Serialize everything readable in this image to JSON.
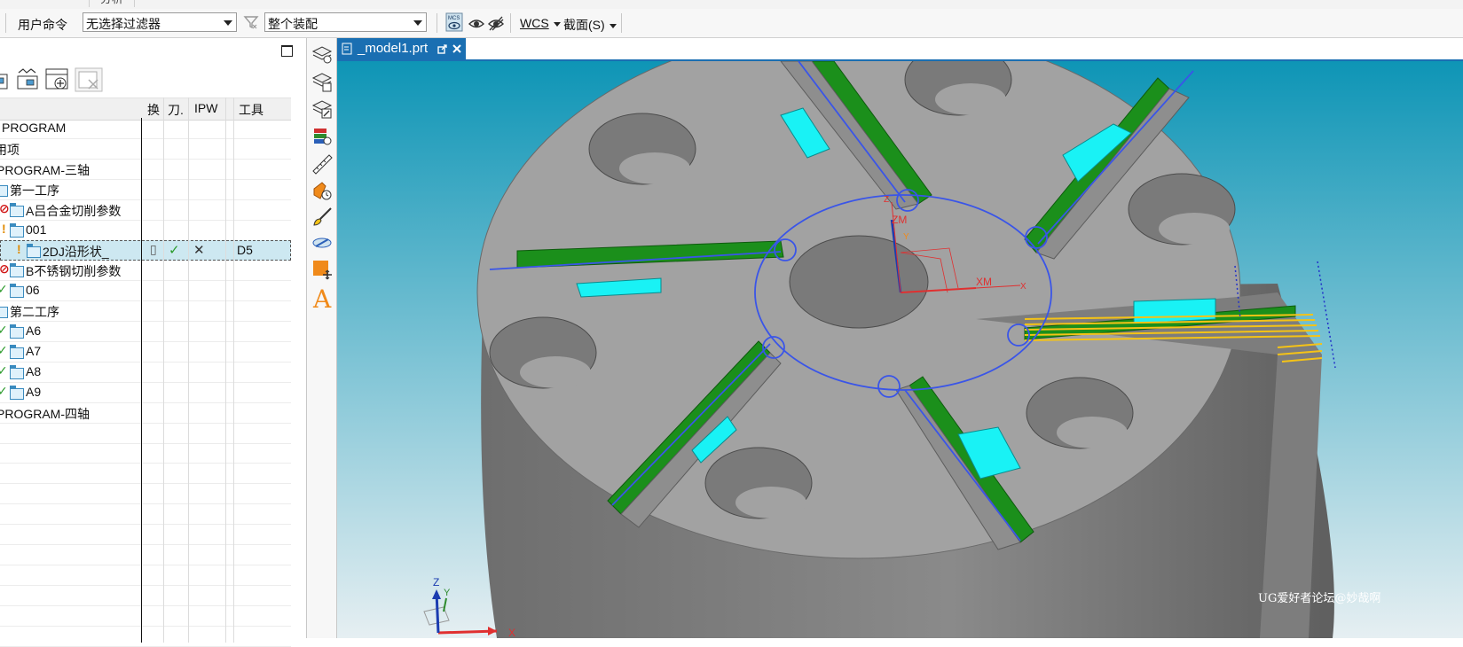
{
  "top_tab": {
    "label": "分析"
  },
  "toolbar": {
    "user_command": "用户命令",
    "filter_value": "无选择过滤器",
    "scope_value": "整个装配",
    "wcs_label": "WCS",
    "section_label": "截面(S)",
    "icons": [
      "mcs-icon",
      "eye-icon",
      "hide-icon",
      "filter-icon"
    ]
  },
  "navigator": {
    "columns": [
      "换",
      "刀.",
      "IPW",
      "工具"
    ],
    "rows": [
      {
        "name": "PROGRAM",
        "status": ""
      },
      {
        "name": "用项",
        "status": ""
      },
      {
        "name": "PROGRAM-三轴",
        "status": ""
      },
      {
        "name": "第一工序",
        "status": ""
      },
      {
        "name": "A吕合金切削参数",
        "status": "prohibited"
      },
      {
        "name": "001",
        "status": "warning"
      },
      {
        "name": "2DJ沿形状_",
        "status": "warning",
        "selected": true,
        "tool": "D5"
      },
      {
        "name": "B不锈钢切削参数",
        "status": "prohibited"
      },
      {
        "name": "06",
        "status": "complete"
      },
      {
        "name": "第二工序",
        "status": ""
      },
      {
        "name": "A6",
        "status": "complete"
      },
      {
        "name": "A7",
        "status": "complete"
      },
      {
        "name": "A8",
        "status": "complete"
      },
      {
        "name": "A9",
        "status": "complete"
      },
      {
        "name": "PROGRAM-四轴",
        "status": ""
      }
    ]
  },
  "graphics": {
    "tab_title": "_model1.prt",
    "csys_labels": {
      "xm": "XM",
      "zm": "ZM",
      "x": "X",
      "z": "Z",
      "y": "Y"
    },
    "triad_labels": {
      "x": "X",
      "y": "Y",
      "z": "Z"
    },
    "watermark": "UG爱好者论坛@妙哉啊"
  },
  "colors": {
    "accent": "#1a6fb2",
    "part_gray": "#a2a2a2",
    "slot_green": "#1b8f1b",
    "pocket_cyan": "#19f2f5",
    "toolpath_blue": "#3a55e8",
    "toolpath_yellow": "#f5c316",
    "bg_top": "#0e95b6",
    "bg_bottom": "#e6eff2"
  }
}
